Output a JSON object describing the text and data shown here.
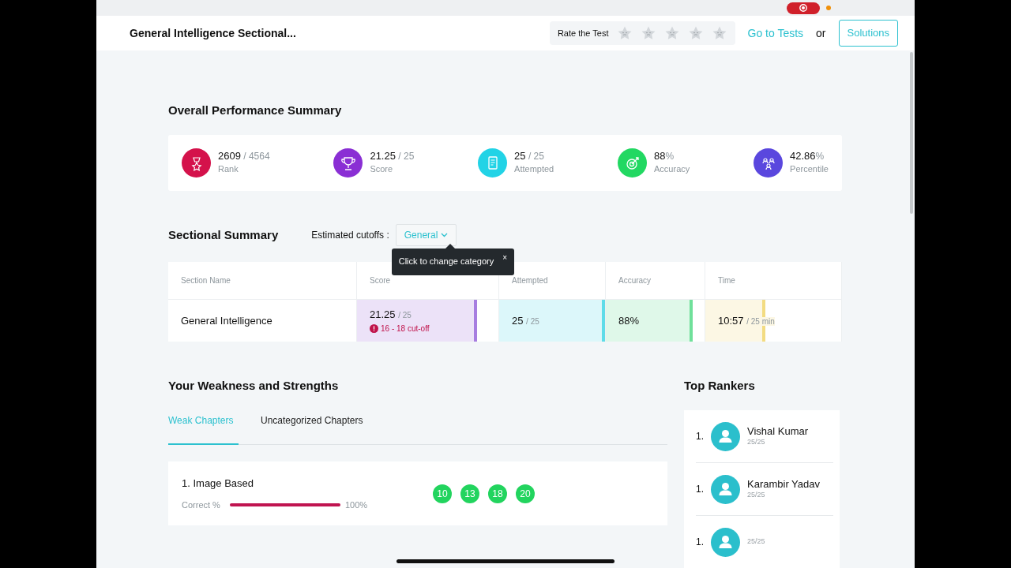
{
  "header": {
    "title": "General Intelligence Sectional...",
    "rating": {
      "label": "Rate the Test",
      "stars": 0
    },
    "go_to_tests": "Go to Tests",
    "or": "or",
    "solutions": "Solutions"
  },
  "overall": {
    "title": "Overall Performance Summary",
    "stats": [
      {
        "kind": "rank",
        "value": "2609",
        "suffix": "/ 4564",
        "label": "Rank",
        "color": "#d4124b"
      },
      {
        "kind": "score",
        "value": "21.25",
        "suffix": "/ 25",
        "label": "Score",
        "color": "#8a2fd4"
      },
      {
        "kind": "attempted",
        "value": "25",
        "suffix": "/ 25",
        "label": "Attempted",
        "color": "#22d3e6"
      },
      {
        "kind": "accuracy",
        "value": "88",
        "suffix": "%",
        "label": "Accuracy",
        "color": "#22d862"
      },
      {
        "kind": "percentile",
        "value": "42.86",
        "suffix": "%",
        "label": "Percentile",
        "color": "#5a47de"
      }
    ]
  },
  "sectional": {
    "title": "Sectional Summary",
    "cutoff_label": "Estimated cutoffs :",
    "category": "General",
    "tooltip": "Click to change category",
    "tooltip_close": "×",
    "columns": [
      "Section Name",
      "Score",
      "Attempted",
      "Accuracy",
      "Time"
    ],
    "rows": [
      {
        "cells": [
          {
            "value": "General Intelligence"
          },
          {
            "value": "21.25",
            "suffix": "/ 25",
            "level": 0.85,
            "color": "#a77de0",
            "note": "16 - 18 cut-off"
          },
          {
            "value": "25",
            "suffix": "/ 25",
            "level": 1,
            "color": "#5fdce8"
          },
          {
            "value": "88%",
            "level": 0.88,
            "color": "#6fe09a"
          },
          {
            "value": "10:57",
            "suffix": "/ 25 min",
            "level": 0.44,
            "color": "#f3dc82"
          }
        ]
      }
    ]
  },
  "weakness": {
    "title": "Your Weakness and Strengths",
    "tabs": [
      {
        "label": "Weak Chapters",
        "selected": true
      },
      {
        "label": "Uncategorized Chapters",
        "selected": false
      }
    ],
    "chapters": [
      {
        "title": "1. Image Based",
        "correct_label": "Correct %",
        "level": 1,
        "percent": "100%",
        "questions": [
          "10",
          "13",
          "18",
          "20"
        ]
      }
    ]
  },
  "rankers": {
    "title": "Top Rankers",
    "items": [
      {
        "rank": "1.",
        "name": "Vishal Kumar",
        "score": "25/25"
      },
      {
        "rank": "1.",
        "name": "Karambir Yadav",
        "score": "25/25"
      },
      {
        "rank": "1.",
        "score": "25/25"
      }
    ]
  }
}
